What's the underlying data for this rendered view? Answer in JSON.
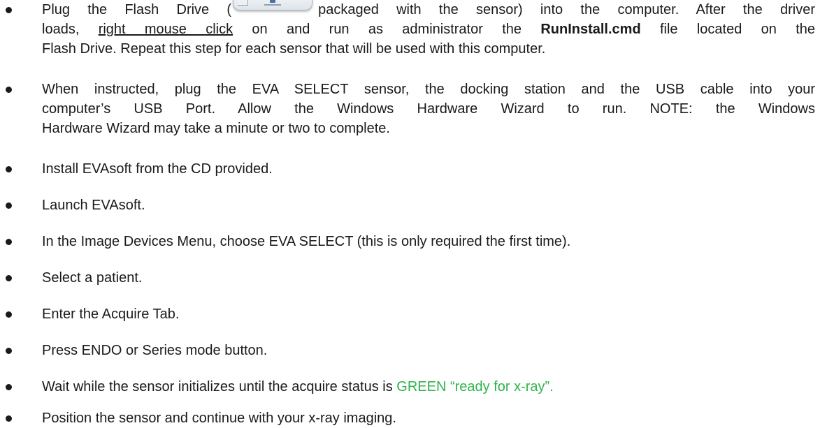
{
  "steps": [
    {
      "lines": [
        [
          "Plug the Flash Drive (",
          "packaged with the sensor) into the computer.  After the driver"
        ],
        [
          "loads, ",
          "right mouse click",
          " on and run as administrator the ",
          "RunInstall.cmd",
          " file located on the"
        ],
        [
          "Flash Drive.  Repeat this step for each sensor that will be used with this computer."
        ]
      ]
    },
    {
      "lines": [
        [
          "When instructed, plug the EVA SELECT sensor, the docking station and the USB cable into your"
        ],
        [
          "computer’s USB Port.  Allow the Windows Hardware Wizard to run.  NOTE: the Windows"
        ],
        [
          "Hardware Wizard may take a minute or two to complete."
        ]
      ]
    },
    {
      "text": "Install EVAsoft from the CD provided."
    },
    {
      "text": "Launch EVAsoft."
    },
    {
      "text": "In the Image Devices Menu, choose EVA SELECT (this is only required the first time)."
    },
    {
      "text": "Select a patient."
    },
    {
      "text": "Enter the Acquire Tab."
    },
    {
      "text": "Press ENDO or Series mode button."
    },
    {
      "text": "Wait while the sensor initializes until the acquire status is ",
      "highlight": "GREEN “ready for x-ray”."
    },
    {
      "text": "Position the sensor and continue with your x-ray imaging."
    }
  ],
  "icons": {
    "flash_drive": "usb-flash-drive-icon"
  },
  "colors": {
    "status_green": "#2fb34a"
  }
}
